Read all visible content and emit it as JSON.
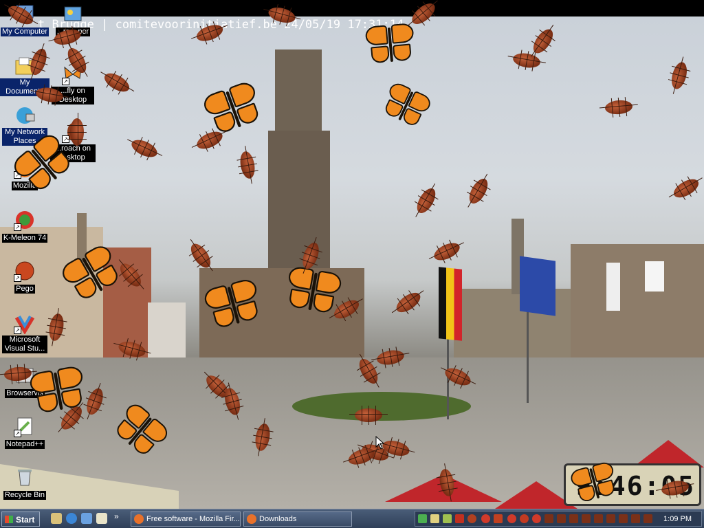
{
  "webcam": {
    "overlay_text": "t Brugge | comitevoorinitiatief.be 24/05/19 17:31:14"
  },
  "desktop_icons": [
    {
      "label": "My Computer",
      "icon": "my-computer-icon"
    },
    {
      "label": "My Documents",
      "icon": "my-documents-icon"
    },
    {
      "label": "My Network Places",
      "icon": "network-places-icon"
    },
    {
      "label": "Mozilla",
      "icon": "firefox-icon"
    },
    {
      "label": "K-Meleon 74",
      "icon": "k-meleon-icon"
    },
    {
      "label": "Pego",
      "icon": "pego-icon"
    },
    {
      "label": "Microsoft Visual Stu...",
      "icon": "visual-studio-icon"
    },
    {
      "label": "Browservis",
      "icon": "browser-icon"
    },
    {
      "label": "Notepad++",
      "icon": "notepadpp-icon"
    },
    {
      "label": "Recycle Bin",
      "icon": "recycle-bin-icon"
    },
    {
      "label": "...m ...per",
      "icon": "wallpaper-icon"
    },
    {
      "label": "...fly on Desktop",
      "icon": "butterfly-icon"
    },
    {
      "label": "...roach on ...sktop",
      "icon": "cockroach-icon"
    }
  ],
  "clock_widget": {
    "digits": "9:46:05"
  },
  "taskbar": {
    "start_label": "Start",
    "quick_launch": [
      "show-desktop-icon",
      "ie-icon",
      "outlook-icon",
      "media-icon"
    ],
    "more_label": "»",
    "tasks": [
      {
        "label": "Free software - Mozilla Fir...",
        "icon": "firefox-icon"
      },
      {
        "label": "Downloads",
        "icon": "firefox-icon"
      }
    ],
    "tray_time": "1:09 PM"
  },
  "colors": {
    "taskbar": "#3a4b66",
    "icon_label_bg": "#0a246a",
    "butterfly_orange": "#f08a1e",
    "roach_brown": "#7a2e14"
  }
}
